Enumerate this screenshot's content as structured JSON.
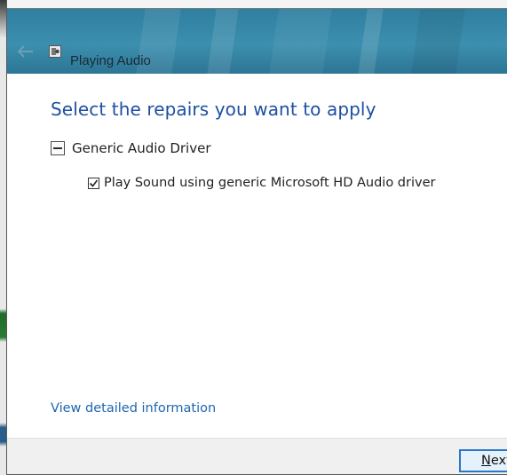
{
  "window": {
    "title": "Playing Audio",
    "app_icon": "troubleshooter-icon",
    "back_icon": "back-arrow-icon"
  },
  "content": {
    "heading": "Select the repairs you want to apply",
    "group": {
      "label": "Generic Audio Driver",
      "expanded": true,
      "items": [
        {
          "label": "Play Sound using generic Microsoft HD Audio driver",
          "checked": true
        }
      ]
    },
    "details_link": "View detailed information"
  },
  "footer": {
    "next_mnemonic": "N",
    "next_rest": "ext"
  },
  "colors": {
    "header": "#3c8fae",
    "heading": "#1e4fa2",
    "link": "#1e66b0",
    "button_border": "#2a77c9"
  }
}
